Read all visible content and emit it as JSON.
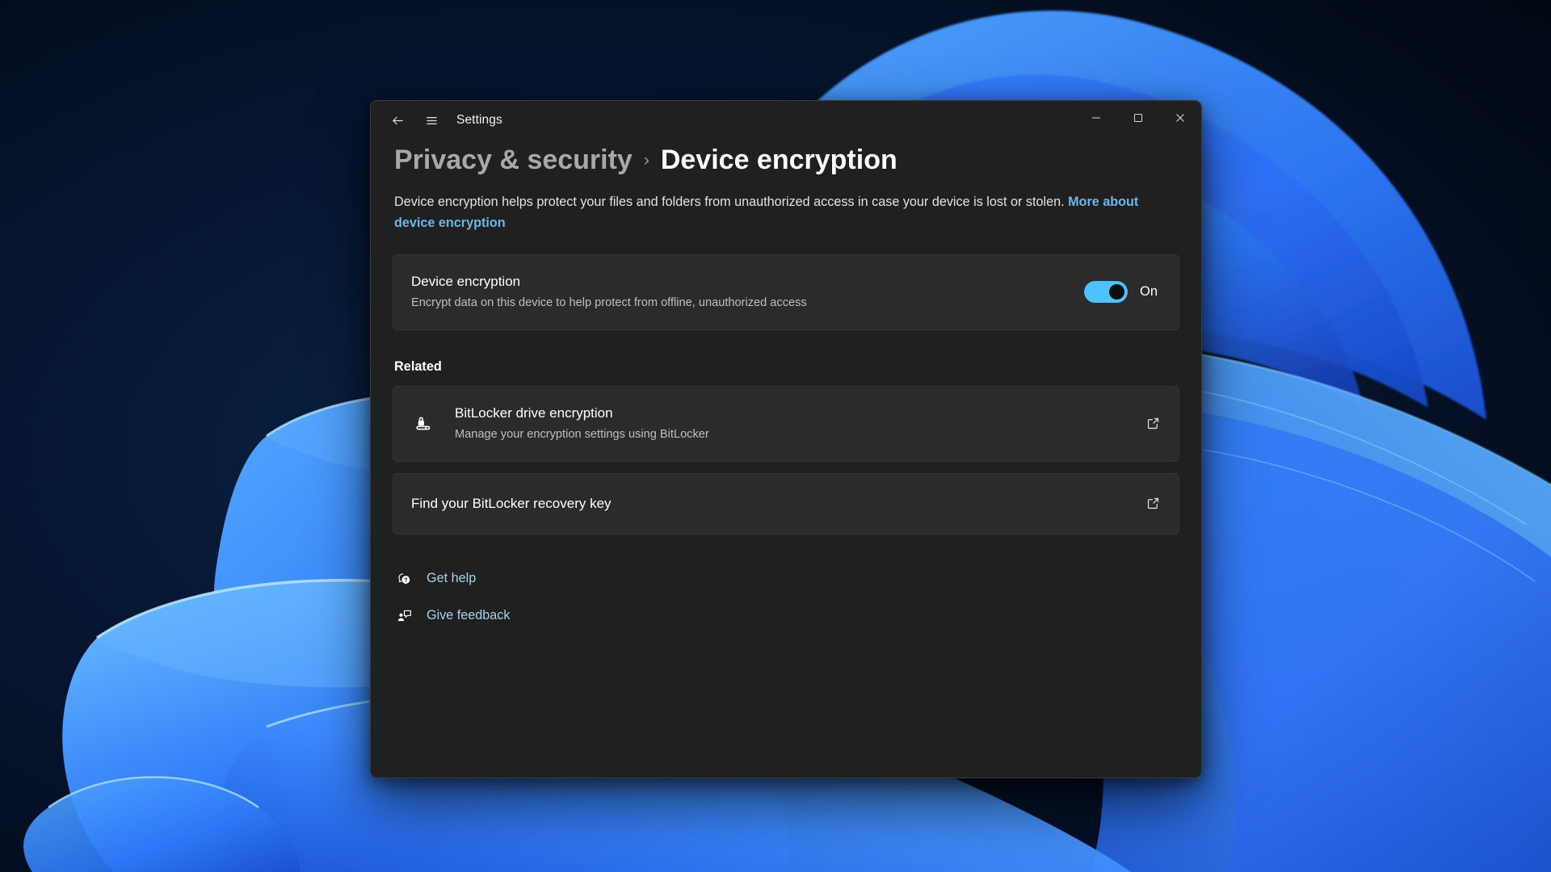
{
  "window": {
    "title": "Settings",
    "back_icon": "back-arrow-icon",
    "menu_icon": "hamburger-menu-icon",
    "minimize_label": "Minimize",
    "maximize_label": "Maximize",
    "close_label": "Close"
  },
  "breadcrumb": {
    "parent": "Privacy & security",
    "separator": "›",
    "current": "Device encryption"
  },
  "description": {
    "text_before": "Device encryption helps protect your files and folders from unauthorized access in case your device is lost or stolen.",
    "link_text": "More about device encryption"
  },
  "device_encryption": {
    "title": "Device encryption",
    "subtitle": "Encrypt data on this device to help protect from offline, unauthorized access",
    "toggle_state": "On",
    "toggle_on": true
  },
  "related": {
    "heading": "Related",
    "items": [
      {
        "title": "BitLocker drive encryption",
        "subtitle": "Manage your encryption settings using BitLocker",
        "icon": "bitlocker-lock-icon",
        "action_icon": "open-external-icon"
      },
      {
        "title": "Find your BitLocker recovery key",
        "subtitle": "",
        "icon": "",
        "action_icon": "open-external-icon"
      }
    ]
  },
  "footer": {
    "links": [
      {
        "label": "Get help",
        "icon": "help-question-bubble-icon"
      },
      {
        "label": "Give feedback",
        "icon": "feedback-person-bubble-icon"
      }
    ]
  },
  "colors": {
    "accent": "#4cc2ff",
    "link": "#6cb6e8",
    "footer_link": "#a4d4e8",
    "window_bg": "#202020",
    "card_bg": "#2b2b2b"
  }
}
